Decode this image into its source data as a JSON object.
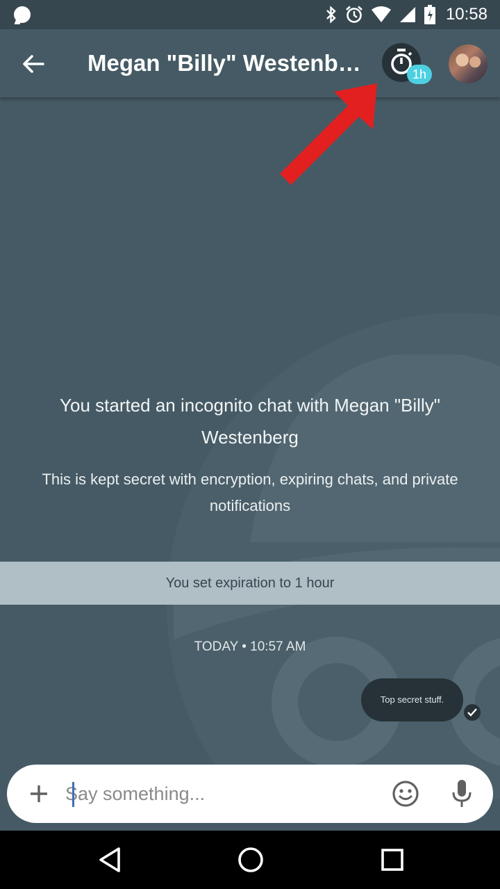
{
  "status_bar": {
    "time": "10:58",
    "icons": [
      "bluetooth-icon",
      "alarm-icon",
      "wifi-icon",
      "signal-icon",
      "battery-icon"
    ]
  },
  "header": {
    "title": "Megan \"Billy\" Westenbe...",
    "back_icon": "arrow-left-icon",
    "timer_icon": "stopwatch-icon",
    "timer_badge": "1h"
  },
  "chat": {
    "intro_title": "You started an incognito chat with Megan \"Billy\" Westenberg",
    "intro_body": "This is kept secret with encryption, expiring chats, and private notifications",
    "expiration_notice": "You set expiration to 1 hour",
    "date_separator": "TODAY • 10:57 AM",
    "messages": [
      {
        "text": "Top secret stuff.",
        "status": "read",
        "outgoing": true
      }
    ]
  },
  "compose": {
    "placeholder": "Say something...",
    "add_icon": "plus-icon",
    "emoji_icon": "smiley-icon",
    "mic_icon": "microphone-icon"
  },
  "nav_bar": {
    "icons": [
      "back-triangle-icon",
      "home-circle-icon",
      "recents-square-icon"
    ]
  },
  "colors": {
    "background": "#455a64",
    "status_bar": "#37474f",
    "bubble": "#263238",
    "badge": "#4dd0e1",
    "banner": "#b0bec5",
    "annotation_arrow": "#e53935"
  }
}
